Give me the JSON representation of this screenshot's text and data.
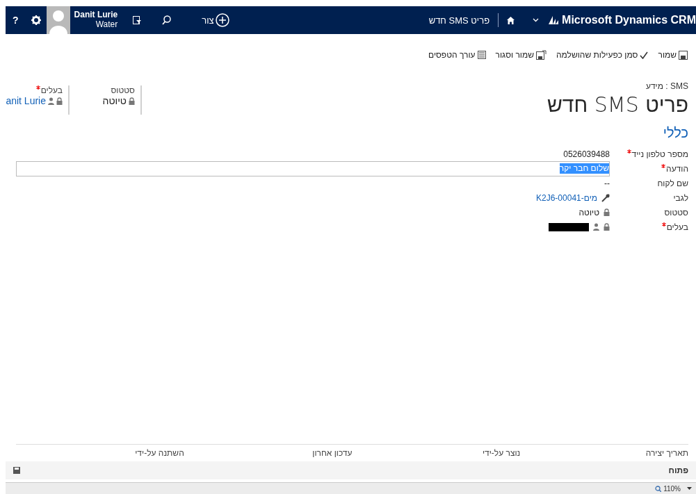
{
  "top_bar": {
    "brand": "Microsoft Dynamics CRM",
    "breadcrumb": "פריט SMS חדש",
    "create_label": "צור",
    "user_name": "Danit Lurie",
    "user_org": "Water",
    "help": "?"
  },
  "command_bar": [
    {
      "label": "שמור"
    },
    {
      "label": "סמן כפעילות שהושלמה"
    },
    {
      "label": "שמור וסגור"
    },
    {
      "label": "עורך הטפסים"
    }
  ],
  "header": {
    "entity": "SMS : מידע",
    "title": "פריט SMS חדש",
    "fields": [
      {
        "label": "סטטוס",
        "value": "טיוטה",
        "required": false,
        "kind": "text"
      },
      {
        "label": "בעלים",
        "value": "anit Lurie",
        "required": true,
        "kind": "user"
      }
    ]
  },
  "section": {
    "title": "כללי",
    "fields": [
      {
        "label": "מספר טלפון נייד",
        "value": "0526039488",
        "required": true,
        "kind": "text"
      },
      {
        "label": "הודעה",
        "value": "שלום חבר יקר",
        "required": true,
        "kind": "input"
      },
      {
        "label": "שם לקוח",
        "value": "--",
        "required": false,
        "kind": "text"
      },
      {
        "label": "לגבי",
        "value": "מים-K2J6-00041",
        "required": false,
        "kind": "link"
      },
      {
        "label": "סטטוס",
        "value": "טיוטה",
        "required": false,
        "kind": "locked"
      },
      {
        "label": "בעלים",
        "required": true,
        "kind": "redacted-user"
      }
    ]
  },
  "footer": {
    "columns": [
      "תאריך יצירה",
      "נוצר על-ידי",
      "עדכון אחרון",
      "השתנה על-ידי"
    ],
    "status": "פתוח",
    "zoom": "110%"
  }
}
